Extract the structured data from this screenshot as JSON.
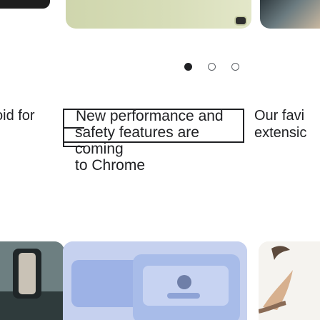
{
  "carousel": {
    "headlines": {
      "left": "oid for",
      "center": [
        "New performance and",
        "safety features are coming",
        "to Chrome"
      ],
      "right": "Our favi extensic"
    },
    "pagination": {
      "active_index": 0,
      "count": 3
    }
  }
}
